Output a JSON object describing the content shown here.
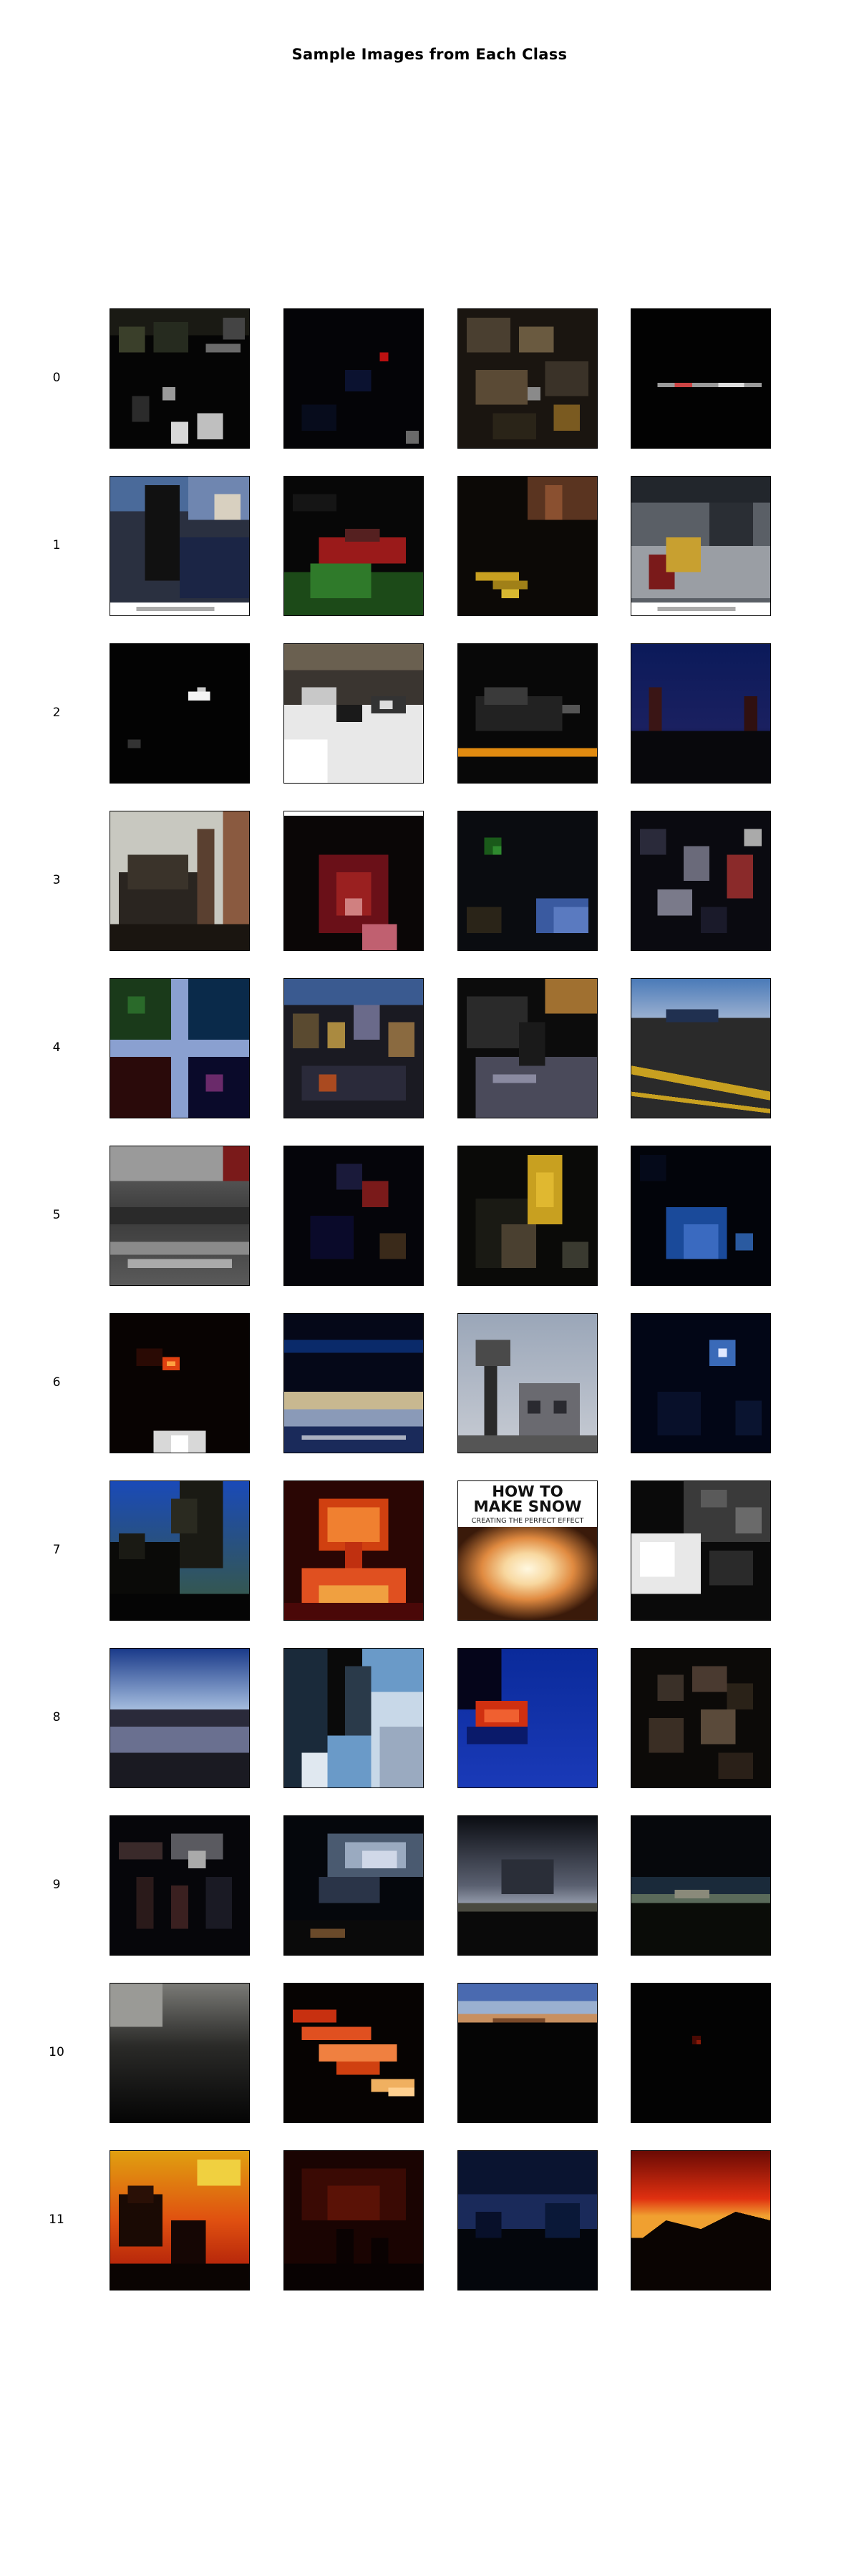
{
  "title": "Sample Images from Each Class",
  "rows": [
    {
      "label": "0",
      "tiles": [
        "night-park-scene",
        "dark-scene-red-spot",
        "debris-rubble",
        "dark-horizontal-streak"
      ]
    },
    {
      "label": "1",
      "tiles": [
        "person-street-scene",
        "green-red-vehicle",
        "dark-interior-yellow",
        "street-crowd-gray"
      ]
    },
    {
      "label": "2",
      "tiles": [
        "dark-white-spot",
        "snow-street-cars",
        "dark-car-orange-line",
        "dusk-blue-sky"
      ]
    },
    {
      "label": "3",
      "tiles": [
        "tilted-building",
        "red-hooded-figure",
        "dark-blue-scene",
        "dark-clutter-red"
      ]
    },
    {
      "label": "4",
      "tiles": [
        "window-cross",
        "crowd-market-blue",
        "dark-road-figure",
        "road-yellow-lines"
      ]
    },
    {
      "label": "5",
      "tiles": [
        "foggy-flooded-street",
        "dark-red-scene",
        "figure-yellow-jacket",
        "blue-glow-dark"
      ]
    },
    {
      "label": "6",
      "tiles": [
        "dark-orange-fire-spot",
        "dark-blue-waterline",
        "bare-tree-house",
        "night-moon-glow"
      ]
    },
    {
      "label": "7",
      "tiles": [
        "smoke-blue-sky",
        "nuclear-explosion",
        "how-to-make-snow-poster",
        "gray-rock-texture"
      ]
    },
    {
      "label": "8",
      "tiles": [
        "lake-sunset-horizon",
        "surfer-wave",
        "red-boat-blue-sea",
        "dark-brown-rocks"
      ]
    },
    {
      "label": "9",
      "tiles": [
        "dark-scene-figures",
        "storm-clouds",
        "tornado-cloud",
        "dark-horizon-field"
      ]
    },
    {
      "label": "10",
      "tiles": [
        "gray-dark-fade",
        "glowing-embers",
        "sky-horizon-dark",
        "dark-faint-red"
      ]
    },
    {
      "label": "11",
      "tiles": [
        "firefighter-fire-orange",
        "dark-red-haze",
        "dark-blue-trees",
        "wildfire-ridge"
      ]
    }
  ],
  "poster": {
    "line1": "HOW TO",
    "line2": "MAKE SNOW",
    "line3": "CREATING THE PERFECT EFFECT"
  }
}
